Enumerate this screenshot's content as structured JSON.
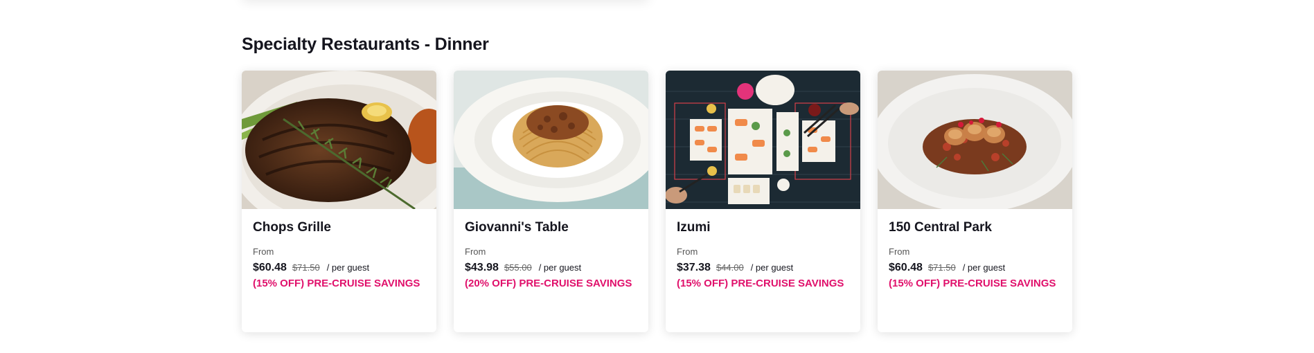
{
  "section": {
    "title": "Specialty Restaurants - Dinner"
  },
  "colors": {
    "accent": "#e0106b",
    "text": "#15151e"
  },
  "restaurants": [
    {
      "name": "Chops Grille",
      "image_icon": "steak-photo",
      "from_label": "From",
      "price": "$60.48",
      "original_price": "$71.50",
      "per_guest": "/ per guest",
      "savings": "(15% OFF) PRE-CRUISE SAVINGS"
    },
    {
      "name": "Giovanni's Table",
      "image_icon": "spaghetti-photo",
      "from_label": "From",
      "price": "$43.98",
      "original_price": "$55.00",
      "per_guest": "/ per guest",
      "savings": "(20% OFF) PRE-CRUISE SAVINGS"
    },
    {
      "name": "Izumi",
      "image_icon": "sushi-photo",
      "from_label": "From",
      "price": "$37.38",
      "original_price": "$44.00",
      "per_guest": "/ per guest",
      "savings": "(15% OFF) PRE-CRUISE SAVINGS"
    },
    {
      "name": "150 Central Park",
      "image_icon": "scallops-photo",
      "from_label": "From",
      "price": "$60.48",
      "original_price": "$71.50",
      "per_guest": "/ per guest",
      "savings": "(15% OFF) PRE-CRUISE SAVINGS"
    }
  ]
}
